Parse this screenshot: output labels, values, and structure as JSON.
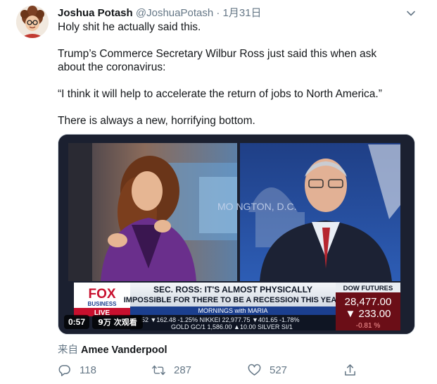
{
  "author": {
    "name": "Joshua Potash",
    "handle": "@JoshuaPotash",
    "separator": "·",
    "date": "1月31日"
  },
  "body": {
    "line1": "Holy shit he actually said this.",
    "line2": "Trump’s Commerce Secretary Wilbur Ross just said this when ask",
    "line3": "about the coronavirus:",
    "line4": "“I think it will help to accelerate the return of jobs to North America.”",
    "line5": "There is always a new, horrifying bottom."
  },
  "video": {
    "duration": "0:57",
    "views": "9万 次观看",
    "channel_logo": "FOX",
    "channel_sub": "BUSINESS",
    "live_badge": "LIVE",
    "watermark": "MO   NGTON, D.C.",
    "headline_line1": "SEC. ROSS: IT'S ALMOST PHYSICALLY",
    "headline_line2": "IMPOSSIBLE FOR THERE TO BE A RECESSION THIS YEAR",
    "show_name": "MORNINGS with MARIA",
    "ticker": "52 ▼162.48 -1.25%  NIKKEI  22,977.75 ▼401.65 -1.78%",
    "ticker2": "GOLD  GC/1  1,586.00 ▲10.00  SILVER  SI/1",
    "futures_label": "DOW FUTURES",
    "futures_value": "28,477.00",
    "futures_change": "▼ 233.00",
    "futures_pct": "-0.81 %"
  },
  "via": {
    "prefix": "来自",
    "name": "Amee Vanderpool"
  },
  "actions": {
    "replies": "118",
    "retweets": "287",
    "likes": "527"
  },
  "colors": {
    "text": "#14171a",
    "muted": "#657786",
    "fox_red": "#c8102e",
    "ticker_blue": "#1b3f8f",
    "headline_bg": "#e9edf2"
  },
  "icons": [
    "caret-down-icon",
    "reply-icon",
    "retweet-icon",
    "like-icon",
    "share-icon"
  ]
}
